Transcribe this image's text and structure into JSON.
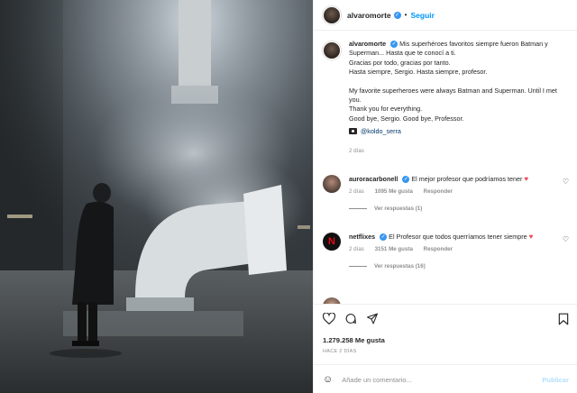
{
  "post": {
    "username": "alvaromorte",
    "follow_label": "Seguir",
    "separator": "•"
  },
  "caption": {
    "username": "alvaromorte",
    "lines_es": [
      "Mis superhéroes favoritos siempre fueron Batman y Superman... Hasta que te conocí a ti.",
      "Gracias por todo, gracias por tanto.",
      "Hasta siempre, Sergio. Hasta siempre, profesor."
    ],
    "lines_en": [
      "My favorite superheroes were always Batman and Superman. Until I met you.",
      "Thank you for everything.",
      "Good bye, Sergio. Good bye, Professor."
    ],
    "credit": "@koldo_serra",
    "time": "2 días"
  },
  "comments": [
    {
      "username": "auroracarbonell",
      "text": "El mejor profesor que podríamos tener",
      "time": "2 días",
      "likes": "1095 Me gusta",
      "reply_label": "Responder",
      "replies_label": "Ver respuestas (1)"
    },
    {
      "username": "netflixes",
      "text": "El Profesor que todos querríamos tener siempre",
      "time": "2 días",
      "likes": "3151 Me gusta",
      "reply_label": "Responder",
      "replies_label": "Ver respuestas (16)"
    }
  ],
  "actions": {
    "likes_count": "1.279.258 Me gusta",
    "date": "HACE 2 DÍAS",
    "add_comment_placeholder": "Añade un comentario...",
    "publish_label": "Publicar"
  },
  "icons": {
    "heart": "heart-icon",
    "comment": "comment-icon",
    "share": "share-icon",
    "bookmark": "bookmark-icon",
    "emoji": "emoji-icon",
    "credit": "camera-icon"
  },
  "colors": {
    "follow": "#0095f6",
    "verified": "#3897f0",
    "heart_red": "#ed4956",
    "publish_disabled": "#b2dffc"
  }
}
